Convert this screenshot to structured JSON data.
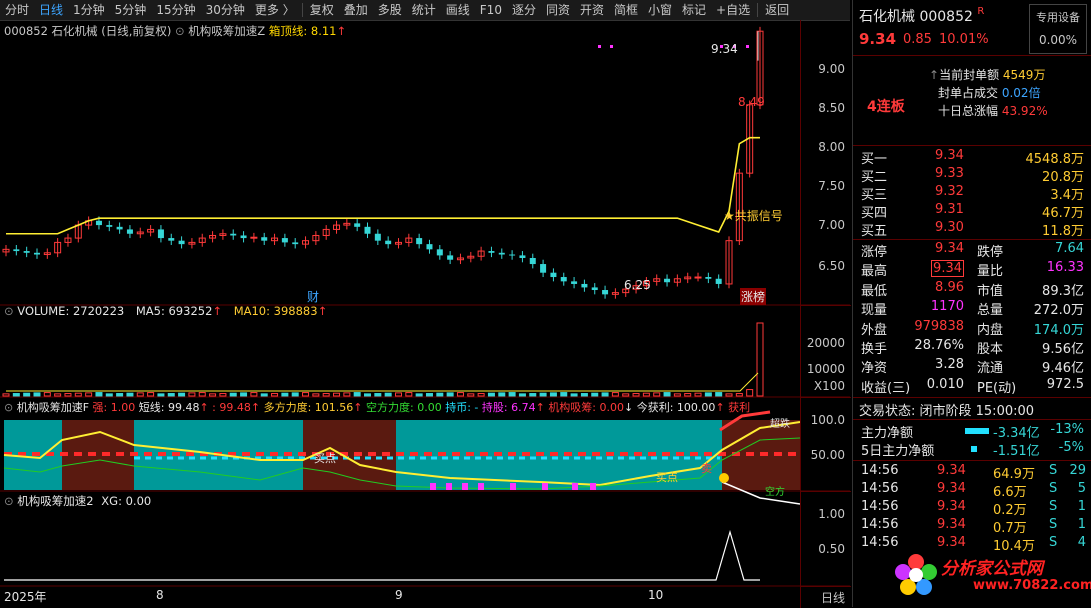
{
  "toolbar": {
    "items": [
      "分时",
      "日线",
      "1分钟",
      "5分钟",
      "15分钟",
      "30分钟",
      "更多 〉",
      "复权",
      "叠加",
      "多股",
      "统计",
      "画线",
      "F10",
      "逐分",
      "同资",
      "开资",
      "简框",
      "小窗",
      "标记",
      "+自选",
      "返回"
    ],
    "active_index": 1
  },
  "main": {
    "title": "000852 石化机械 (日线,前复权)",
    "indicator": "机构吸筹加速Z",
    "box_top_label": "箱顶线: 8.11",
    "y_labels": [
      "9.00",
      "8.50",
      "8.00",
      "7.50",
      "7.00",
      "6.50"
    ],
    "annotations": {
      "high": "9.34",
      "high2": "8.49",
      "low": "6.25",
      "signal": "★共振信号",
      "fin": "财",
      "limit": "涨榜"
    }
  },
  "volume": {
    "label": "VOLUME: 2720223",
    "ma5": "MA5: 693252",
    "ma10": "MA10: 398883",
    "y_labels": [
      "20000",
      "10000"
    ],
    "unit": "X100"
  },
  "ind1": {
    "name": "机构吸筹加速F",
    "strong": "强: 1.00",
    "short": "短线: 99.48",
    "short2": ": 99.48",
    "force": "多方力度: 101.56",
    "empty": "空方力度: 0.00",
    "hold": "持币: -",
    "holdshare": "持股: 6.74",
    "inst": "机构吸筹: 0.00",
    "today": "今获利: 100.00",
    "win": "获利",
    "y_labels": [
      "100.0",
      "50.00"
    ],
    "buy1": "买点",
    "buy2": "买点",
    "sell": "卖",
    "overtop": "超跌",
    "kong": "空方"
  },
  "ind2": {
    "name": "机构吸筹加速2",
    "xg": "XG: 0.00",
    "y_labels": [
      "1.00",
      "0.50"
    ]
  },
  "xaxis": {
    "labels": [
      "2025年",
      "8",
      "9",
      "10"
    ],
    "period": "日线"
  },
  "right": {
    "name": "石化机械",
    "code": "000852",
    "r_mark": "R",
    "special": "专用设备",
    "special_pct": "0.00%",
    "price": "9.34",
    "change": "0.85",
    "pct": "10.01%",
    "board": "4连板",
    "seal_label": "当前封单额",
    "seal_val": "4549万",
    "seal_ratio_label": "封单占成交",
    "seal_ratio": "0.02倍",
    "ten_label": "十日总涨幅",
    "ten_val": "43.92%",
    "buys": [
      [
        "买一",
        "9.34",
        "4548.8万"
      ],
      [
        "买二",
        "9.33",
        "20.8万"
      ],
      [
        "买三",
        "9.32",
        "3.4万"
      ],
      [
        "买四",
        "9.31",
        "46.7万"
      ],
      [
        "买五",
        "9.30",
        "11.8万"
      ]
    ],
    "stats": [
      [
        "涨停",
        "9.34",
        "跌停",
        "7.64"
      ],
      [
        "最高",
        "9.34",
        "量比",
        "16.33"
      ],
      [
        "最低",
        "8.96",
        "市值",
        "89.3亿"
      ],
      [
        "现量",
        "1170",
        "总量",
        "272.0万"
      ],
      [
        "外盘",
        "979838",
        "内盘",
        "174.0万"
      ],
      [
        "换手",
        "28.76%",
        "股本",
        "9.56亿"
      ],
      [
        "净资",
        "3.28",
        "流通",
        "9.46亿"
      ],
      [
        "收益(三)",
        "0.010",
        "PE(动)",
        "972.5"
      ]
    ],
    "trade_state": "交易状态: 闭市阶段 15:00:00",
    "flow": [
      [
        "主力净额",
        "-3.34亿",
        "-13%"
      ],
      [
        "5日主力净额",
        "-1.51亿",
        "-5%"
      ]
    ],
    "ticks": [
      [
        "14:56",
        "9.34",
        "64.9万",
        "S",
        "29"
      ],
      [
        "14:56",
        "9.34",
        "6.6万",
        "S",
        "5"
      ],
      [
        "14:56",
        "9.34",
        "0.2万",
        "S",
        "1"
      ],
      [
        "14:56",
        "9.34",
        "0.7万",
        "S",
        "1"
      ],
      [
        "14:56",
        "9.34",
        "10.4万",
        "S",
        "4"
      ]
    ],
    "watermark": "分析家公式网",
    "watermark_url": "www.70822.com"
  },
  "chart_data": {
    "type": "candlestick",
    "title": "000852 石化机械 (日线,前复权)",
    "ylim": [
      6.2,
      9.4
    ],
    "close_series": [
      6.82,
      6.8,
      6.78,
      6.76,
      6.78,
      6.9,
      6.95,
      7.1,
      7.15,
      7.1,
      7.08,
      7.05,
      7.0,
      7.02,
      7.05,
      6.95,
      6.92,
      6.88,
      6.9,
      6.95,
      6.98,
      7.0,
      6.98,
      6.95,
      6.96,
      6.92,
      6.95,
      6.9,
      6.88,
      6.92,
      6.98,
      7.05,
      7.1,
      7.12,
      7.08,
      7.0,
      6.92,
      6.88,
      6.9,
      6.95,
      6.88,
      6.82,
      6.75,
      6.7,
      6.72,
      6.74,
      6.8,
      6.78,
      6.76,
      6.75,
      6.72,
      6.65,
      6.55,
      6.5,
      6.45,
      6.42,
      6.38,
      6.35,
      6.3,
      6.32,
      6.36,
      6.4,
      6.45,
      6.48,
      6.44,
      6.48,
      6.5,
      6.5,
      6.48,
      6.42,
      6.92,
      7.7,
      8.49,
      9.34
    ],
    "box_top": 8.11
  }
}
